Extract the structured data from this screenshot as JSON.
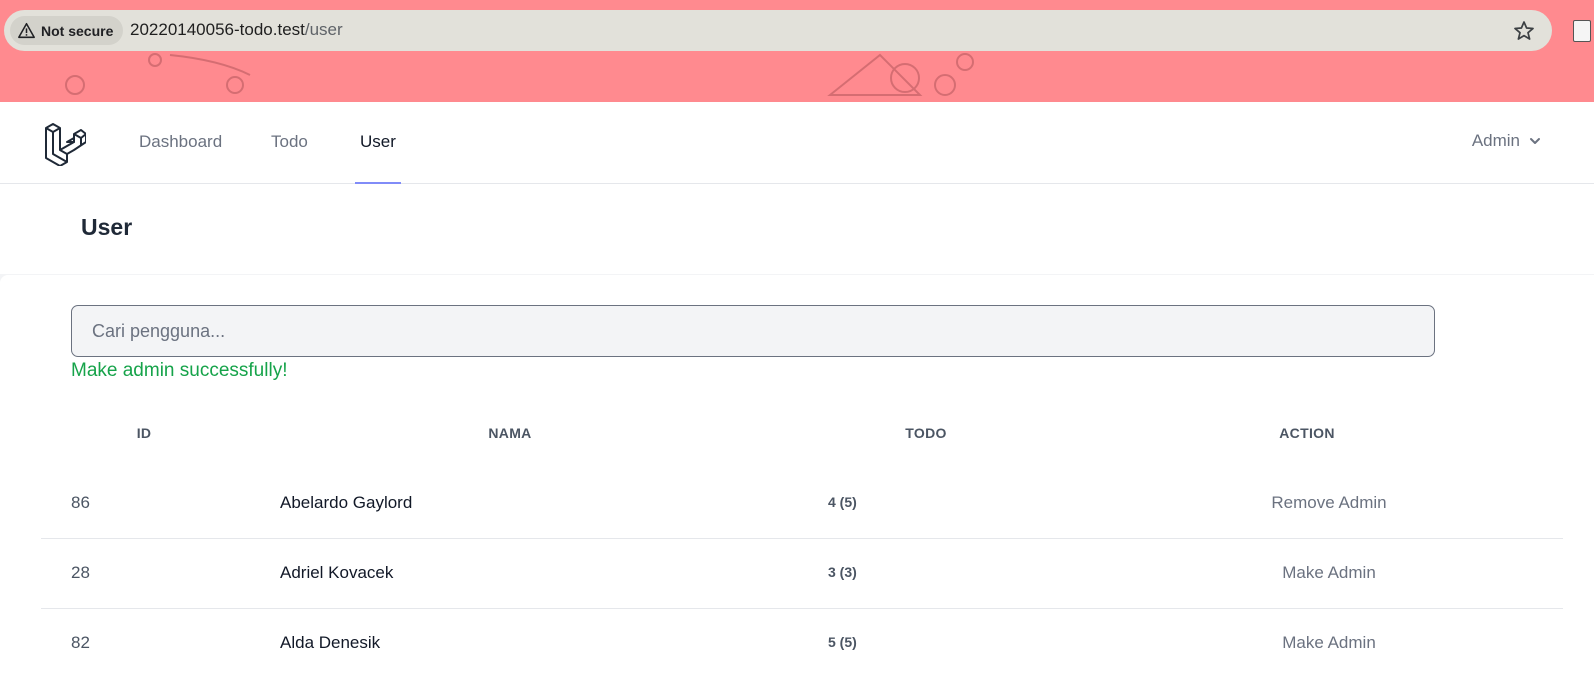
{
  "browser": {
    "security_label": "Not secure",
    "url_host": "20220140056-todo.test",
    "url_path": "/user"
  },
  "nav": {
    "links": [
      {
        "label": "Dashboard",
        "active": false
      },
      {
        "label": "Todo",
        "active": false
      },
      {
        "label": "User",
        "active": true
      }
    ],
    "user_menu": "Admin"
  },
  "header": {
    "title": "User"
  },
  "search": {
    "placeholder": "Cari pengguna..."
  },
  "flash_message": "Make admin successfully!",
  "table": {
    "columns": [
      "ID",
      "NAMA",
      "TODO",
      "ACTION"
    ],
    "rows": [
      {
        "id": "86",
        "name": "Abelardo Gaylord",
        "todo": "4 (5)",
        "action": "Remove Admin"
      },
      {
        "id": "28",
        "name": "Adriel Kovacek",
        "todo": "3 (3)",
        "action": "Make Admin"
      },
      {
        "id": "82",
        "name": "Alda Denesik",
        "todo": "5 (5)",
        "action": "Make Admin"
      }
    ]
  },
  "colors": {
    "chrome_bg": "#ff8a8f",
    "active_nav_underline": "#818cf8",
    "flash_green": "#16a34a"
  }
}
